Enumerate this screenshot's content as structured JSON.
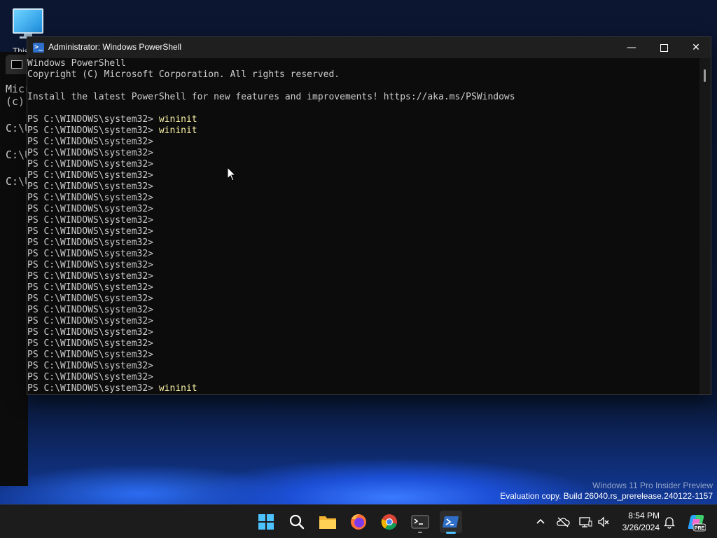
{
  "desktop": {
    "icon_label": "This PC"
  },
  "background_cmd": {
    "lines": [
      "Micr",
      "(c)",
      "C:\\U",
      "C:\\U",
      "C:\\U"
    ]
  },
  "powershell": {
    "title": "Administrator: Windows PowerShell",
    "controls": {
      "minimize": "—",
      "close": "✕"
    },
    "header_lines": [
      "Windows PowerShell",
      "Copyright (C) Microsoft Corporation. All rights reserved.",
      "",
      "Install the latest PowerShell for new features and improvements! https://aka.ms/PSWindows",
      ""
    ],
    "prompt": "PS C:\\WINDOWS\\system32> ",
    "commands": [
      "wininit",
      "wininit",
      "",
      "",
      "",
      "",
      "",
      "",
      "",
      "",
      "",
      "",
      "",
      "",
      "",
      "",
      "",
      "",
      "",
      "",
      "",
      "",
      "",
      "",
      "wininit"
    ]
  },
  "watermark": {
    "line1": "Windows 11 Pro Insider Preview",
    "line2": "Evaluation copy. Build 26040.rs_prerelease.240122-1157"
  },
  "taskbar": {
    "clock_time": "8:54 PM",
    "clock_date": "3/26/2024",
    "copilot_badge": "PRE"
  },
  "colors": {
    "accent": "#4cc2ff",
    "console_bg": "#0c0c0c",
    "console_fg": "#cccccc",
    "command_fg": "#f9f1a5"
  }
}
